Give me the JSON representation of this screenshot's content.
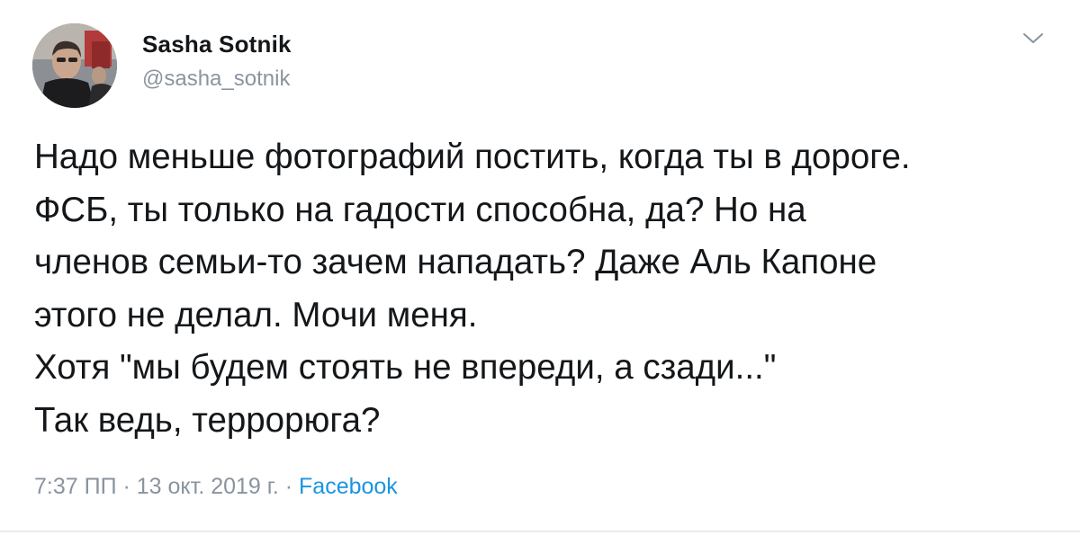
{
  "author": {
    "name": "Sasha Sotnik",
    "handle": "@sasha_sotnik"
  },
  "tweet": {
    "text": "Надо меньше фотографий постить, когда ты в дороге.\nФСБ, ты только на гадости способна, да? Но на\nчленов семьи-то зачем нападать? Даже Аль Капоне\nэтого не делал. Мочи меня.\nХотя \"мы будем стоять не впереди, а сзади...\"\nТак ведь, террорюга?"
  },
  "meta": {
    "time": "7:37 ПП",
    "separator1": " · ",
    "date": "13 окт. 2019 г.",
    "separator2": " · ",
    "source": "Facebook"
  },
  "icons": {
    "menu": "chevron-down-icon",
    "avatar": "avatar"
  },
  "colors": {
    "text": "#14171a",
    "muted": "#8a949e",
    "link": "#1b95e0",
    "divider": "#e6ecf0"
  }
}
